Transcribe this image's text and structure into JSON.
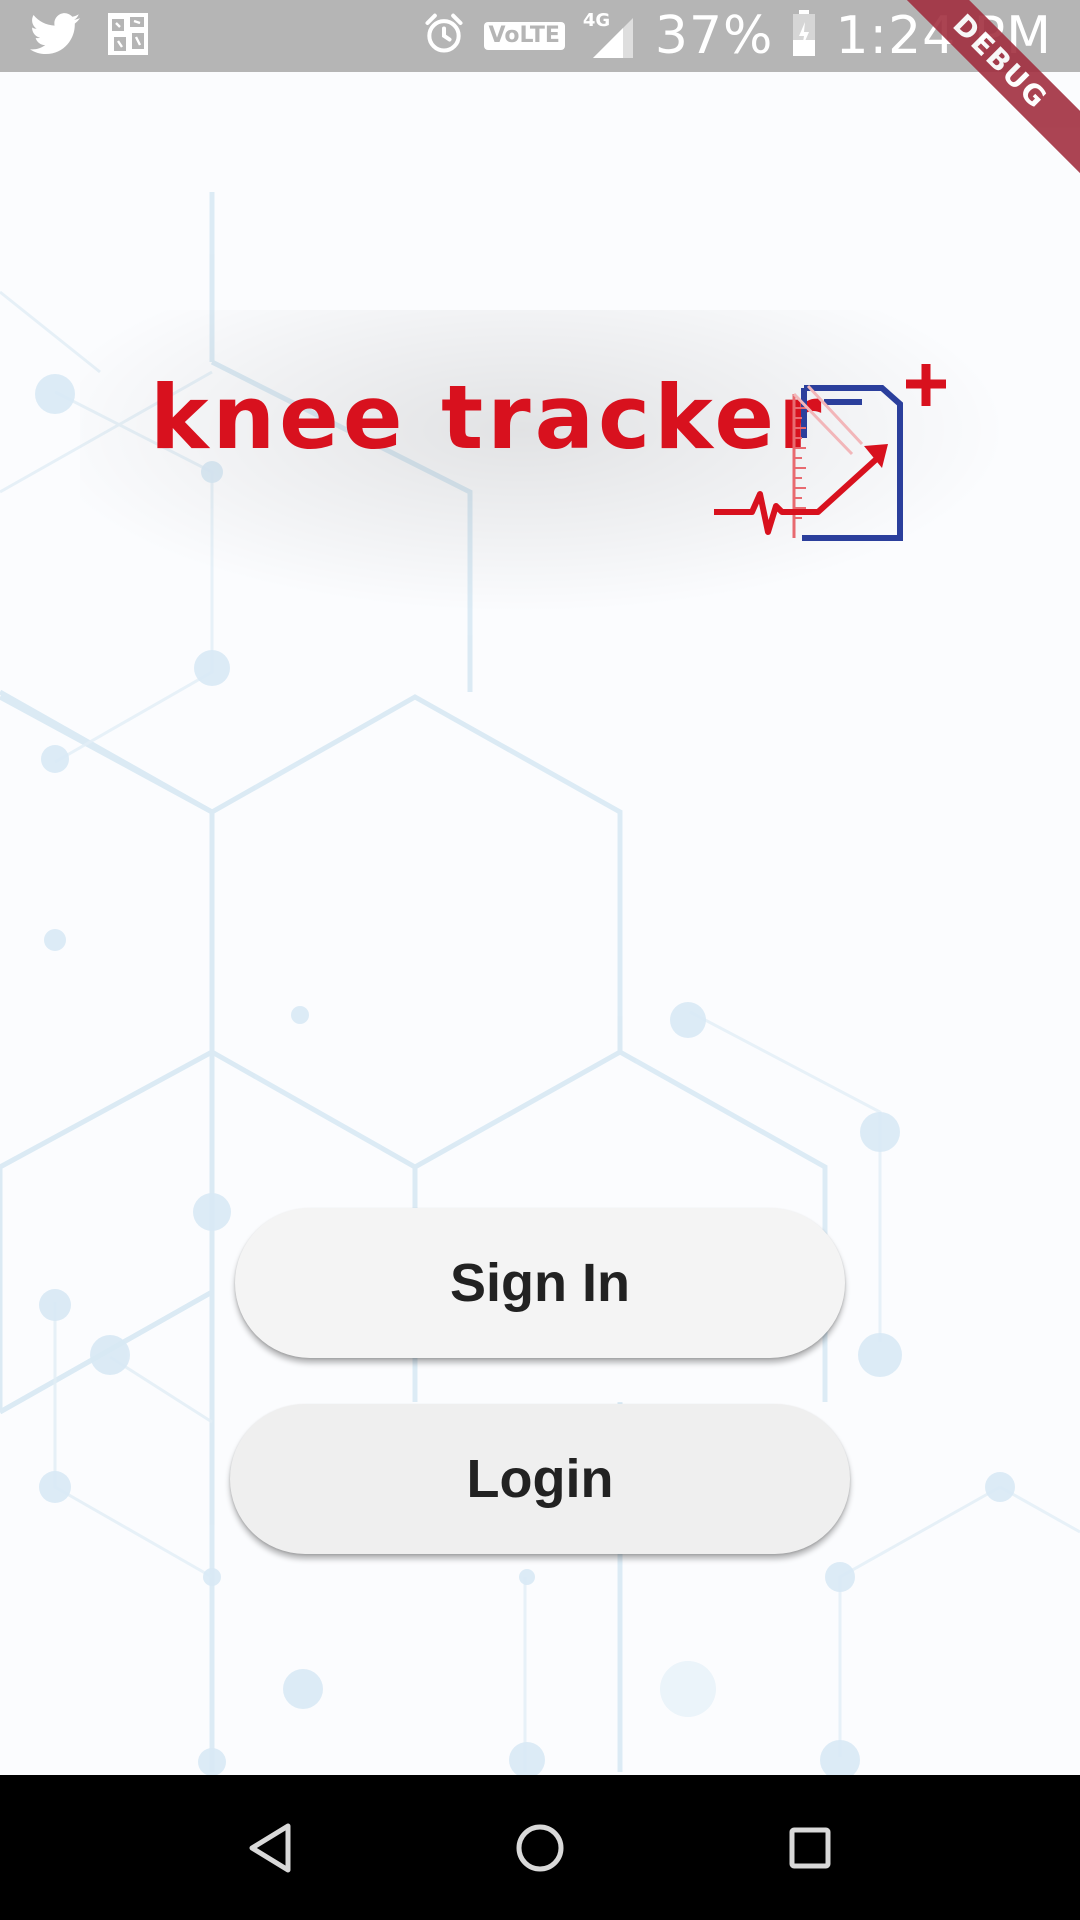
{
  "status_bar": {
    "time": "1:24 PM",
    "battery_percent": "37%",
    "volte_label": "VoLTE",
    "network_label": "4G",
    "icons": [
      "twitter-icon",
      "gallery-icon",
      "alarm-icon",
      "volte-icon",
      "signal-icon",
      "battery-icon"
    ]
  },
  "debug_banner": "DEBUG",
  "logo": {
    "text": "knee tracker",
    "brand_red": "#d8111e",
    "brand_blue": "#2b3f9c"
  },
  "buttons": {
    "sign_in": "Sign In",
    "login": "Login"
  },
  "nav_bar": {
    "icons": [
      "back-icon",
      "home-icon",
      "recents-icon"
    ]
  }
}
